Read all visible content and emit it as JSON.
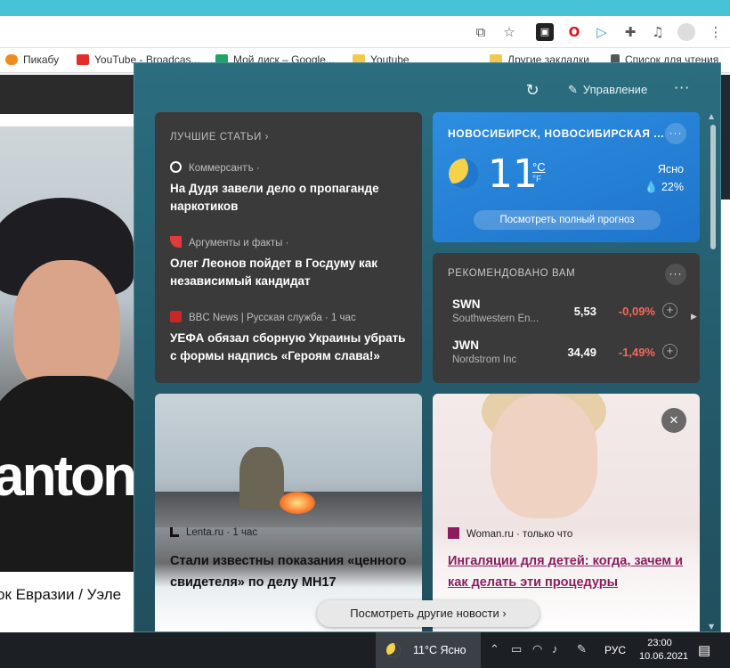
{
  "bookmarks": [
    {
      "label": "Пикабу",
      "color": "#f08c1e"
    },
    {
      "label": "YouTube - Broadcas...",
      "color": "#e52d27"
    },
    {
      "label": "Мой диск – Google...",
      "color": "#1fa463"
    },
    {
      "label": "Youtube",
      "color": "#f2c94c"
    },
    {
      "label": "Другие закладки",
      "color": "#f2c94c"
    },
    {
      "label": "Список для чтения",
      "color": "#555555"
    }
  ],
  "page": {
    "video_brand": "antoni",
    "caption": "ок Евразии / Уэле"
  },
  "panel": {
    "manage_label": "Управление",
    "top_stories": {
      "header": "ЛУЧШИЕ СТАТЬИ",
      "items": [
        {
          "source": "Коммерсантъ ·",
          "title": "На Дудя завели дело о пропаганде наркотиков",
          "icon_color": "#ffffff"
        },
        {
          "source": "Аргументы и факты ·",
          "title": "Олег Леонов пойдет в Госдуму как независимый кандидат",
          "icon_color": "#e03a3a"
        },
        {
          "source": "BBC News | Русская служба · 1 час",
          "title": "УЕФА обязал сборную Украины убрать с формы надпись «Героям слава!»",
          "icon_color": "#c62828"
        }
      ]
    },
    "weather": {
      "location": "НОВОСИБИРСК, НОВОСИБИРСКАЯ ...",
      "temp": "11",
      "unit_c": "°C",
      "unit_f": "°F",
      "condition": "Ясно",
      "humidity": "22%",
      "button": "Посмотреть полный прогноз"
    },
    "recommended": {
      "header": "РЕКОМЕНДОВАНО ВАМ",
      "stocks": [
        {
          "symbol": "SWN",
          "name": "Southwestern En...",
          "price": "5,53",
          "change": "-0,09%"
        },
        {
          "symbol": "JWN",
          "name": "Nordstrom Inc",
          "price": "34,49",
          "change": "-1,49%"
        }
      ]
    },
    "news": [
      {
        "source": "Lenta.ru · 1 час",
        "title": "Стали известны показания «ценного свидетеля» по делу MH17"
      },
      {
        "source": "Woman.ru · только что",
        "title": "Ингаляции для детей: когда, зачем и как делать эти процедуры"
      }
    ],
    "more_news": "Посмотреть другие новости"
  },
  "taskbar": {
    "weather": "11°C  Ясно",
    "lang": "РУС",
    "time": "23:00",
    "date": "10.06.2021"
  },
  "colors": {
    "panel_bg": "#245c6d",
    "weather_bg": "#1f74cc",
    "negative": "#f26a5a",
    "card_dark": "#3a3a3a"
  }
}
